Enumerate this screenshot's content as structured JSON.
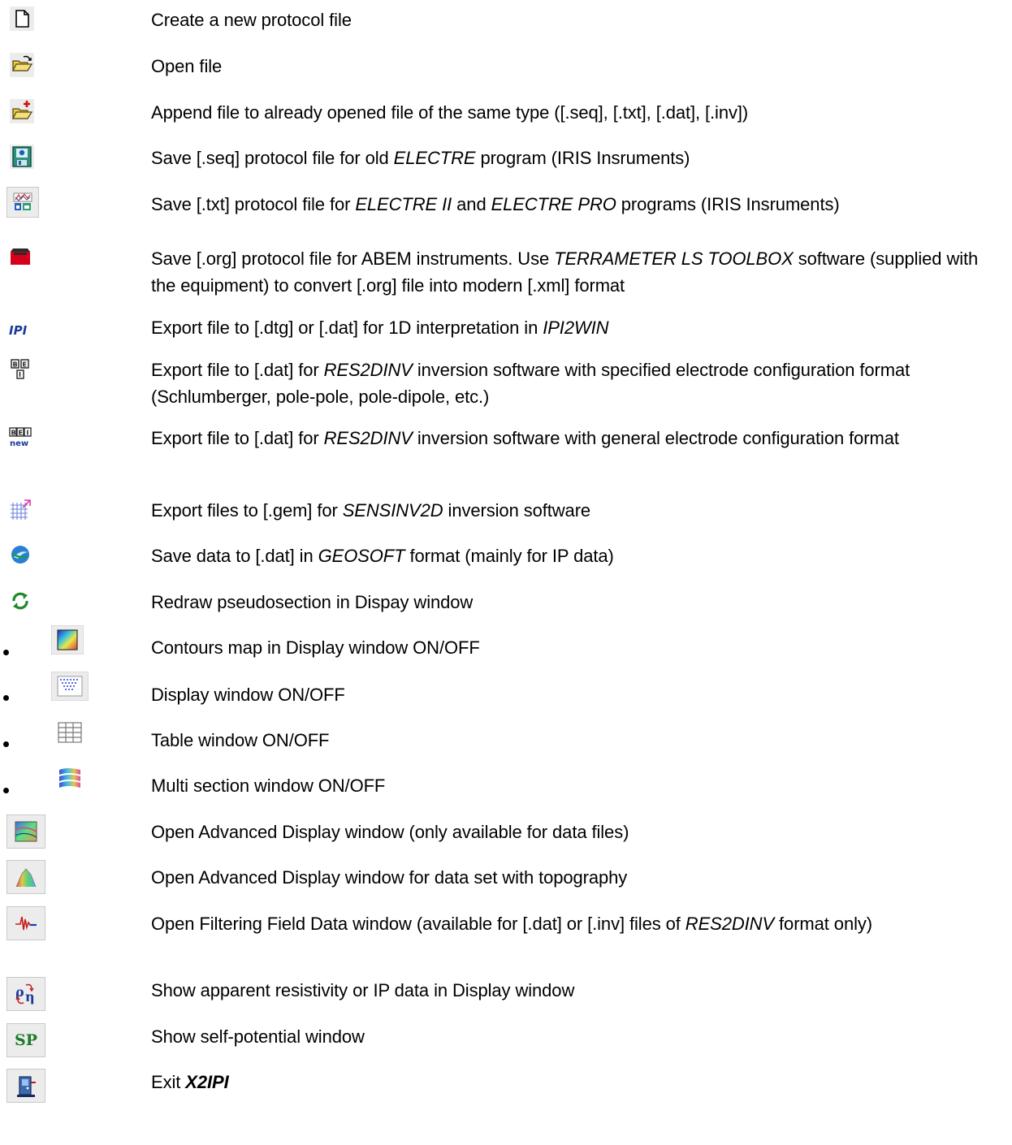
{
  "items": [
    {
      "icon": "new-file-icon",
      "text": [
        "Create a new protocol file"
      ]
    },
    {
      "icon": "open-folder-icon",
      "text": [
        "Open file"
      ]
    },
    {
      "icon": "append-file-icon",
      "text": [
        "Append file to already opened file of the same type ([.seq], [.txt], [.dat], [.inv])"
      ]
    },
    {
      "icon": "save-seq-icon",
      "text": [
        "Save [.seq] protocol file for old ",
        "ELECTRE",
        " program (IRIS Insruments)"
      ]
    },
    {
      "icon": "save-txt-icon",
      "text": [
        "Save [.txt] protocol file for ",
        "ELECTRE II",
        " and ",
        "ELECTRE PRO",
        " programs (IRIS Insruments)"
      ]
    },
    {
      "icon": "save-org-icon",
      "text": [
        "Save [.org] protocol file for ABEM instruments. Use ",
        "TERRAMETER LS TOOLBOX",
        " software (supplied with the equipment) to convert [.org] file into modern [.xml] format"
      ]
    },
    {
      "icon": "ipi-export-icon",
      "text": [
        "Export file to [.dtg] or [.dat] for 1D interpretation in ",
        "IPI2WIN"
      ]
    },
    {
      "icon": "res2dinv-specified-icon",
      "text": [
        "Export file to [.dat] for ",
        "RES2DINV",
        " inversion software with specified electrode configuration format (Schlumberger, pole-pole, pole-dipole, etc.)"
      ]
    },
    {
      "icon": "res2dinv-general-icon",
      "text": [
        "Export file to [.dat] for ",
        "RES2DINV",
        " inversion software with general electrode configuration format"
      ]
    },
    {
      "icon": "sensinv-grid-icon",
      "text": [
        "Export files to [.gem] for ",
        "SENSINV2D",
        " inversion software"
      ]
    },
    {
      "icon": "geosoft-icon",
      "text": [
        "Save data to [.dat] in ",
        "GEOSOFT",
        " format (mainly for IP data)"
      ]
    },
    {
      "icon": "redraw-icon",
      "text": [
        "Redraw pseudosection in Dispay window"
      ]
    },
    {
      "icon": "contour-map-icon",
      "text": [
        "Contours map in Display window ON/OFF"
      ]
    },
    {
      "icon": "display-window-icon",
      "text": [
        "Display window ON/OFF"
      ]
    },
    {
      "icon": "table-window-icon",
      "text": [
        "Table window ON/OFF"
      ]
    },
    {
      "icon": "multi-section-icon",
      "text": [
        "Multi section window ON/OFF"
      ]
    },
    {
      "icon": "advanced-display-icon",
      "text": [
        "Open Advanced Display window (only available for data files)"
      ]
    },
    {
      "icon": "topography-display-icon",
      "text": [
        "Open Advanced Display window for data set with topography"
      ]
    },
    {
      "icon": "filtering-icon",
      "text": [
        "Open Filtering Field Data window (available for [.dat] or [.inv] files of ",
        "RES2DINV",
        " format only)"
      ]
    },
    {
      "icon": "resistivity-ip-icon",
      "text": [
        "Show apparent resistivity or IP data in Display window"
      ]
    },
    {
      "icon": "self-potential-icon",
      "text": [
        "Show self-potential window"
      ],
      "icon_label": "SP"
    },
    {
      "icon": "exit-icon",
      "text": [
        "Exit ",
        "X2IPI"
      ]
    },
    {
      "icon": "",
      "text": [
        ""
      ]
    }
  ],
  "colors": {
    "text": "#000000",
    "button_face": "#ececec",
    "button_border": "#c9c9c9"
  }
}
